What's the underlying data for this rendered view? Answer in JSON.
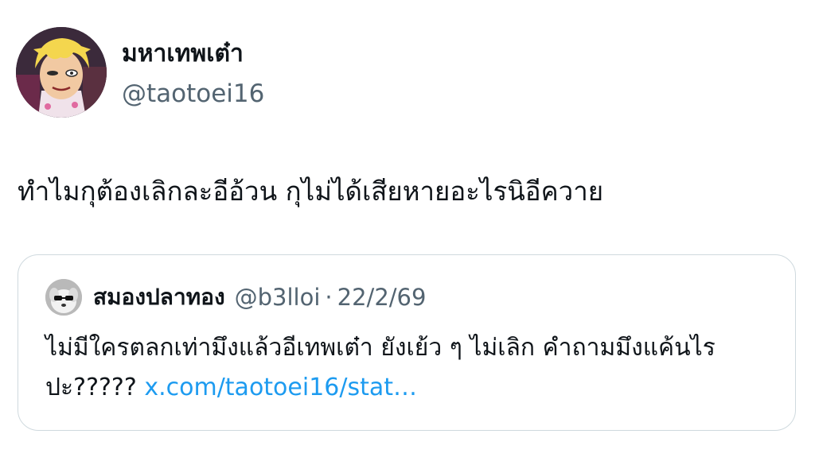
{
  "tweet": {
    "author": {
      "display_name": "มหาเทพเต๋า",
      "handle": "@taotoei16",
      "avatar_icon": "anime-character-avatar"
    },
    "text": "ทำไมกุต้องเลิกละอีอ้วน กุไม่ได้เสียหายอะไรนิอีควาย"
  },
  "quote": {
    "author": {
      "display_name": "สมองปลาทอง",
      "handle": "@b3lloi",
      "separator": "·",
      "date": "22/2/69",
      "avatar_icon": "dog-sunglasses-avatar"
    },
    "text": "ไม่มีใครตลกเท่ามึงแล้วอีเทพเต๋า ยังเย้ว ๆ ไม่เลิก คำถามมึงแค้นไรปะ?????",
    "link": "x.com/taotoei16/stat…"
  },
  "colors": {
    "text": "#0f1419",
    "secondary": "#536471",
    "link": "#1d9bf0",
    "border": "#cfd9de"
  }
}
